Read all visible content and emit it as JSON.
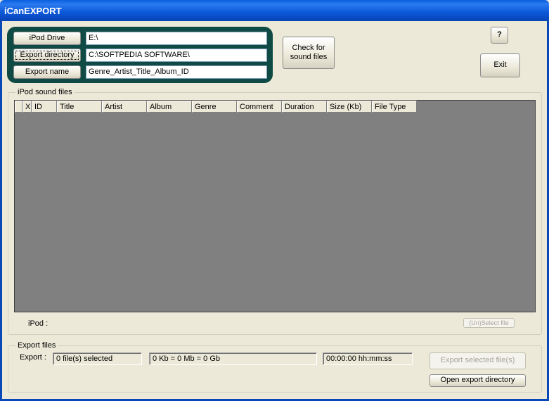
{
  "window": {
    "title": "iCanEXPORT"
  },
  "settings": {
    "ipod_drive": {
      "label": "iPod Drive",
      "value": "E:\\"
    },
    "export_directory": {
      "label": "Export directory",
      "value": "C:\\SOFTPEDIA SOFTWARE\\"
    },
    "export_name": {
      "label": "Export name",
      "value": "Genre_Artist_Title_Album_ID"
    }
  },
  "buttons": {
    "check_line1": "Check for",
    "check_line2": "sound files",
    "help": "?",
    "exit": "Exit",
    "select_file": "(Un)Select file",
    "export_selected": "Export selected file(s)",
    "open_export_dir": "Open export directory"
  },
  "sound_files": {
    "legend": "iPod sound files",
    "columns": [
      "",
      "X",
      "ID",
      "Title",
      "Artist",
      "Album",
      "Genre",
      "Comment",
      "Duration",
      "Size (Kb)",
      "File Type"
    ],
    "ipod_label": "iPod :",
    "ipod_value": ""
  },
  "export_files": {
    "legend": "Export files",
    "export_label": "Export :",
    "selected_count": "0 file(s) selected",
    "size": "0 Kb = 0 Mb = 0 Gb",
    "duration": "00:00:00 hh:mm:ss"
  },
  "colors": {
    "titlebar": "#0a5fe0",
    "panel": "#0f4a44",
    "grid": "#808080",
    "face": "#ece9d8"
  }
}
